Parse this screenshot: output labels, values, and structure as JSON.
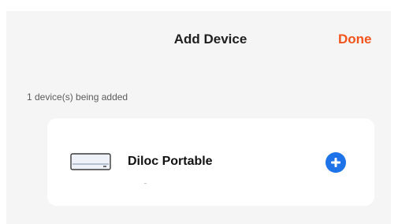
{
  "header": {
    "title": "Add Device",
    "done_label": "Done"
  },
  "status_text": "1 device(s) being added",
  "device": {
    "name": "Diloc Portable",
    "icon": "air-conditioner-icon",
    "action_icon": "plus-circle-icon"
  },
  "colors": {
    "accent": "#f2541c",
    "add_button": "#1f73e8"
  }
}
